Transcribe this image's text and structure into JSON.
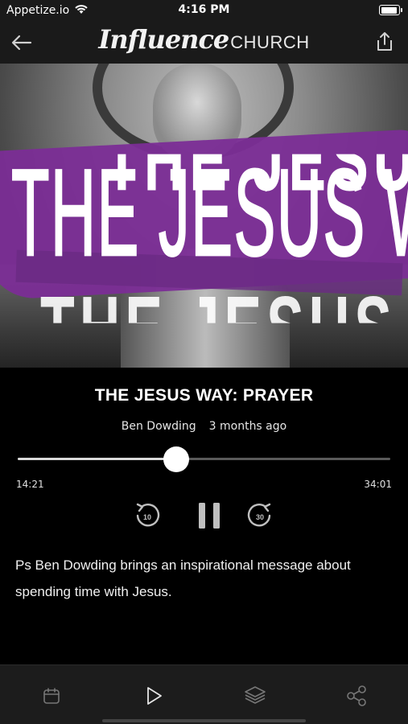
{
  "status_bar": {
    "carrier": "Appetize.io",
    "time": "4:16 PM",
    "wifi_icon": "wifi-icon",
    "battery_icon": "battery-icon"
  },
  "header": {
    "brand_script": "Influence",
    "brand_word": "CHURCH",
    "back_icon": "arrow-left-icon",
    "share_icon": "share-icon"
  },
  "artwork": {
    "title_text": "THE JESUS WAY",
    "accent_color": "#7b2d96"
  },
  "sermon": {
    "title": "THE JESUS WAY: PRAYER",
    "speaker": "Ben Dowding",
    "posted": "3 months ago",
    "description": "Ps Ben Dowding brings an inspirational message about spending time with Jesus."
  },
  "player": {
    "elapsed": "14:21",
    "duration": "34:01",
    "progress": 0.425,
    "rewind_seconds": "10",
    "forward_seconds": "30",
    "state": "playing"
  },
  "tab_bar": {
    "tabs": [
      {
        "icon": "calendar-icon",
        "active": false
      },
      {
        "icon": "play-icon",
        "active": true
      },
      {
        "icon": "layers-icon",
        "active": false
      },
      {
        "icon": "share-nodes-icon",
        "active": false
      }
    ]
  }
}
